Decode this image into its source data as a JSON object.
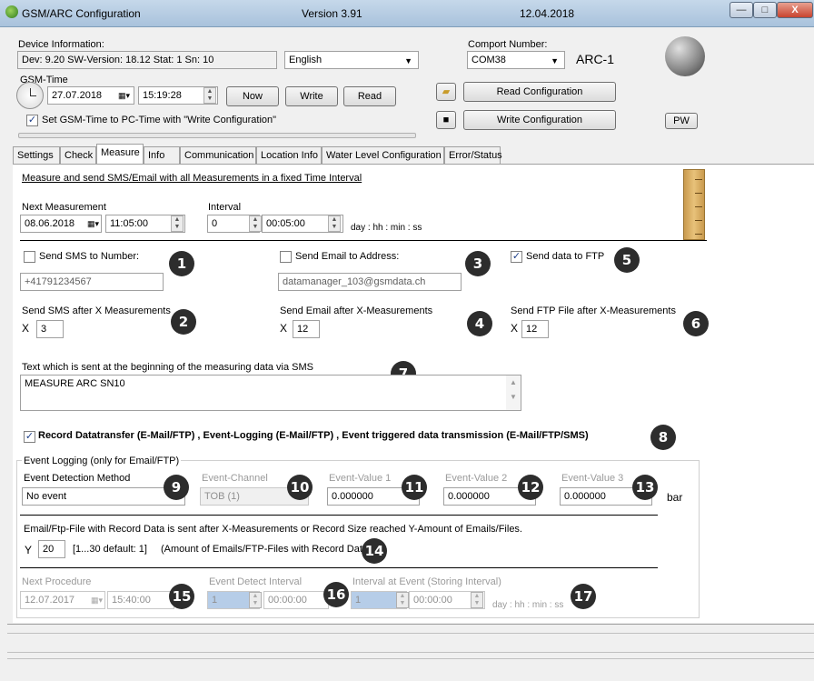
{
  "window": {
    "title": "GSM/ARC Configuration",
    "version": "Version 3.91",
    "date": "12.04.2018",
    "min": "—",
    "max": "□",
    "close": "X"
  },
  "device": {
    "label": "Device Information:",
    "info": "Dev: 9.20 SW-Version: 18.12 Stat: 1  Sn: 10",
    "language": "English",
    "comport_label": "Comport Number:",
    "comport": "COM38",
    "device_name": "ARC-1"
  },
  "gsm_time": {
    "label": "GSM-Time",
    "date": "27.07.2018",
    "time": "15:19:28",
    "now": "Now",
    "write": "Write",
    "read": "Read",
    "sync_label": "Set GSM-Time to PC-Time with \"Write Configuration\""
  },
  "config": {
    "read": "Read Configuration",
    "write": "Write Configuration",
    "pw": "PW"
  },
  "tabs": [
    "Settings",
    "Check",
    "Measure",
    "Info",
    "Communication",
    "Location Info",
    "Water Level Configuration",
    "Error/Status"
  ],
  "measure": {
    "title": "Measure and send SMS/Email with all Measurements in a fixed Time Interval",
    "next_label": "Next Measurement",
    "next_date": "08.06.2018",
    "next_time": "11:05:00",
    "interval_label": "Interval",
    "interval_days": "0",
    "interval_time": "00:05:00",
    "interval_units": "day : hh : min : ss"
  },
  "sms": {
    "label": "Send SMS to Number:",
    "number": "+41791234567",
    "after_label": "Send SMS after X Measurements",
    "x": "X",
    "after_value": "3"
  },
  "email": {
    "label": "Send Email to Address:",
    "address": "datamanager_103@gsmdata.ch",
    "after_label": "Send Email after X-Measurements",
    "x": "X",
    "after_value": "12"
  },
  "ftp": {
    "label": "Send data to FTP",
    "after_label": "Send FTP File after X-Measurements",
    "x": "X",
    "after_value": "12"
  },
  "sms_text": {
    "label": "Text which is sent at the beginning of the measuring data via SMS",
    "value": "MEASURE ARC SN10"
  },
  "record": {
    "label": "Record Datatransfer (E-Mail/FTP) ,  Event-Logging (E-Mail/FTP) ,  Event triggered data transmission (E-Mail/FTP/SMS)"
  },
  "event": {
    "group_label": "Event Logging (only for Email/FTP)",
    "method_label": "Event Detection Method",
    "method_value": "No event",
    "channel_label": "Event-Channel",
    "channel_value": "TOB (1)",
    "value1_label": "Event-Value 1",
    "value1": "0.000000",
    "value2_label": "Event-Value 2",
    "value2": "0.000000",
    "value3_label": "Event-Value 3",
    "value3": "0.000000",
    "unit": "bar",
    "record_text": "Email/Ftp-File with Record Data is sent after X-Measurements or Record Size reached Y-Amount of Emails/Files.",
    "y_label": "Y",
    "y_value": "20",
    "y_range": "[1...30  default: 1]",
    "y_note": "(Amount of Emails/FTP-Files with Record Data)",
    "next_proc_label": "Next Procedure",
    "next_proc_date": "12.07.2017",
    "next_proc_time": "15:40:00",
    "detect_interval_label": "Event Detect Interval",
    "detect_interval_days": "1",
    "detect_interval_time": "00:00:00",
    "event_interval_label": "Interval at Event (Storing Interval)",
    "event_interval_days": "1",
    "event_interval_time": "00:00:00",
    "interval_units": "day : hh : min : ss"
  },
  "markers": [
    "1",
    "2",
    "3",
    "4",
    "5",
    "6",
    "7",
    "8",
    "9",
    "10",
    "11",
    "12",
    "13",
    "14",
    "15",
    "16",
    "17"
  ]
}
